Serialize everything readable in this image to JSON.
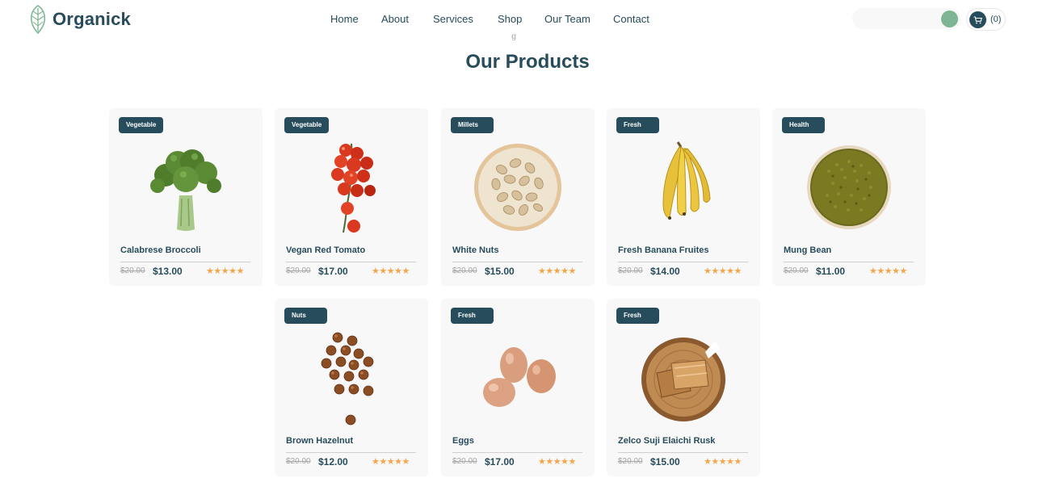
{
  "brand": {
    "name": "Organick",
    "accent": "#274c5b",
    "green": "#7eb693"
  },
  "nav": [
    {
      "label": "Home"
    },
    {
      "label": "About"
    },
    {
      "label": "Services"
    },
    {
      "label": "Shop"
    },
    {
      "label": "Our Team"
    },
    {
      "label": "Contact"
    }
  ],
  "header": {
    "cart_count": "(0)",
    "search_icon": "search-icon",
    "cart_icon": "cart-icon"
  },
  "section": {
    "subtitle_fragment": "g",
    "title": "Our Products"
  },
  "products": [
    {
      "category": "Vegetable",
      "name": "Calabrese Broccoli",
      "old_price": "$20.00",
      "price": "$13.00",
      "rating": 5,
      "stars": "★★★★★"
    },
    {
      "category": "Vegetable",
      "name": "Vegan Red Tomato",
      "old_price": "$20.00",
      "price": "$17.00",
      "rating": 5,
      "stars": "★★★★★"
    },
    {
      "category": "Millets",
      "name": "White Nuts",
      "old_price": "$20.00",
      "price": "$15.00",
      "rating": 5,
      "stars": "★★★★★"
    },
    {
      "category": "Fresh",
      "name": "Fresh Banana Fruites",
      "old_price": "$20.00",
      "price": "$14.00",
      "rating": 5,
      "stars": "★★★★★"
    },
    {
      "category": "Health",
      "name": "Mung Bean",
      "old_price": "$20.00",
      "price": "$11.00",
      "rating": 5,
      "stars": "★★★★★"
    },
    {
      "category": "Nuts",
      "name": "Brown Hazelnut",
      "old_price": "$20.00",
      "price": "$12.00",
      "rating": 5,
      "stars": "★★★★★"
    },
    {
      "category": "Fresh",
      "name": "Eggs",
      "old_price": "$20.00",
      "price": "$17.00",
      "rating": 5,
      "stars": "★★★★★"
    },
    {
      "category": "Fresh",
      "name": "Zelco Suji Elaichi Rusk",
      "old_price": "$20.00",
      "price": "$15.00",
      "rating": 5,
      "stars": "★★★★★"
    }
  ]
}
